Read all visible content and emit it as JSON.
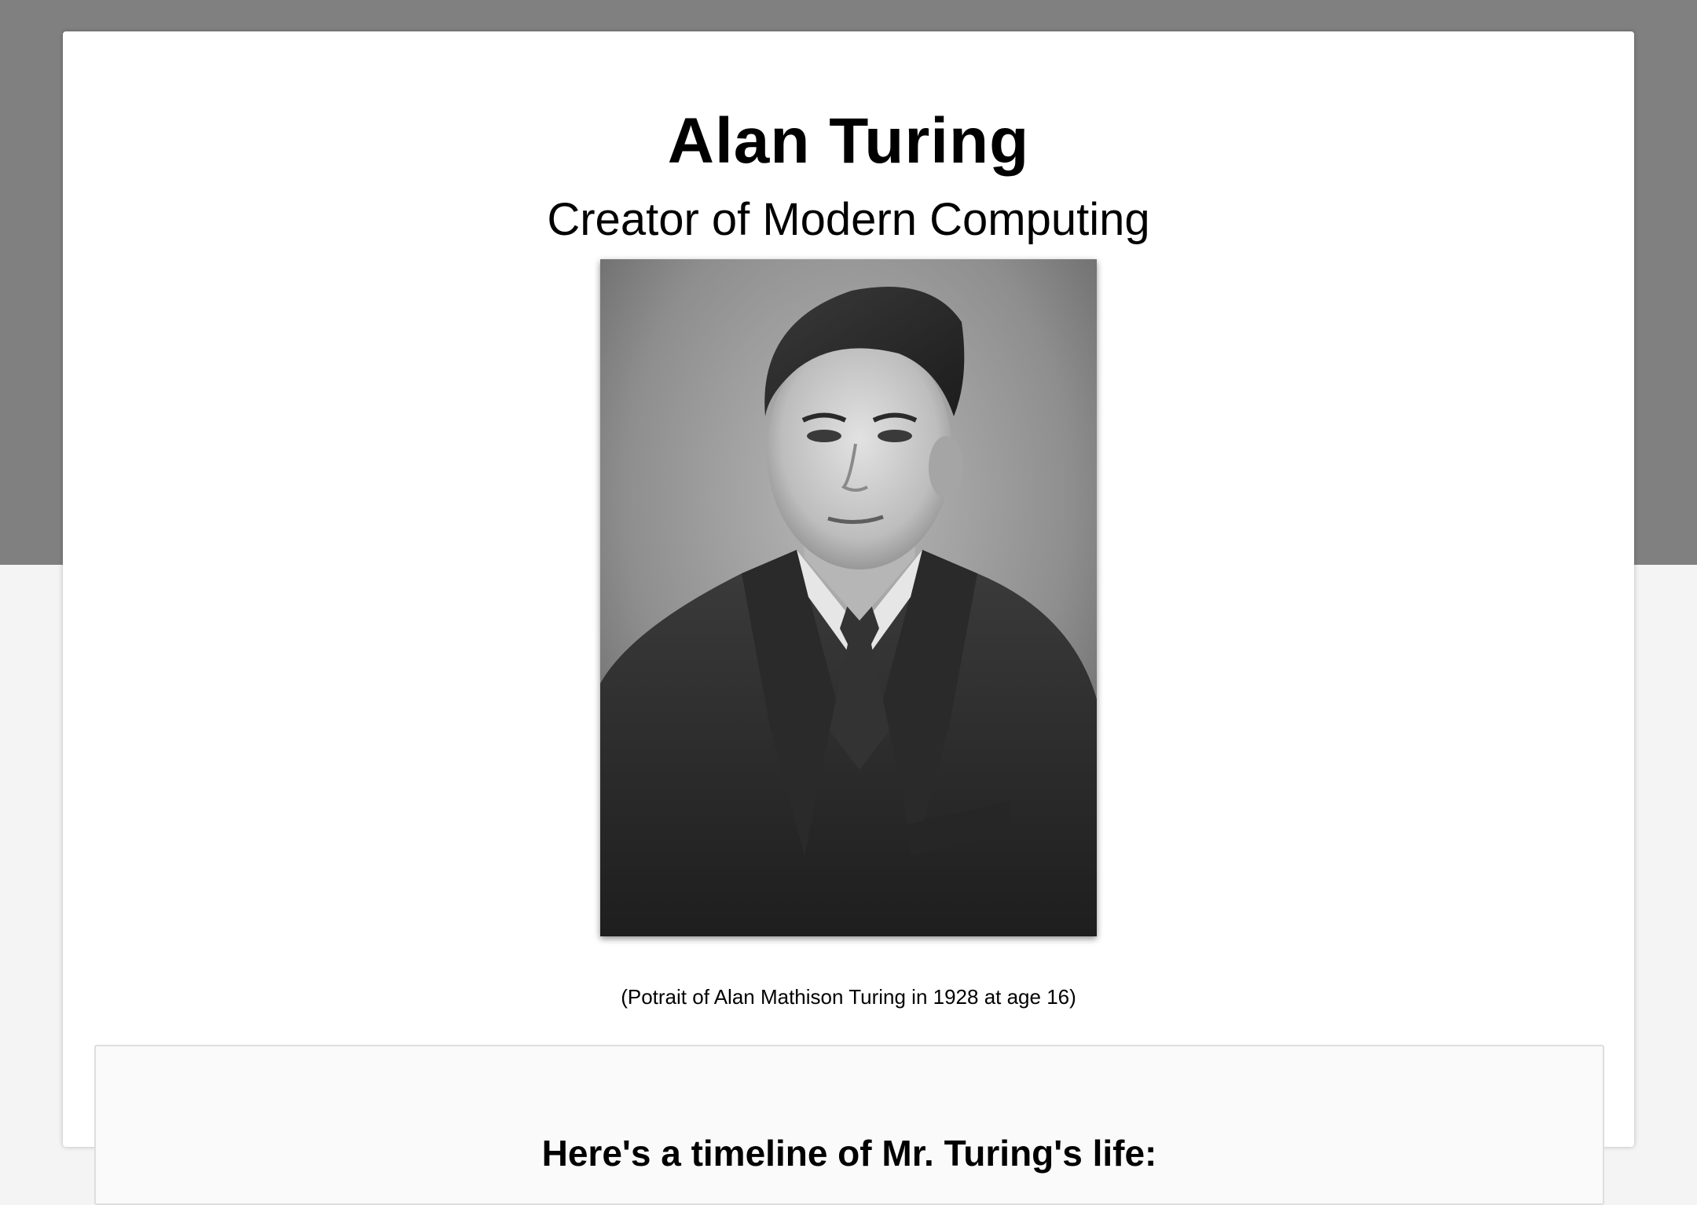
{
  "header": {
    "title": "Alan Turing",
    "subtitle": "Creator of Modern Computing"
  },
  "portrait": {
    "caption": "(Potrait of Alan Mathison Turing in 1928 at age 16)"
  },
  "timeline": {
    "heading": "Here's a timeline of Mr. Turing's life:"
  },
  "colors": {
    "top_band": "#808080",
    "page_background": "#f4f4f4",
    "card_background": "#ffffff",
    "timeline_background": "#fafafa"
  }
}
